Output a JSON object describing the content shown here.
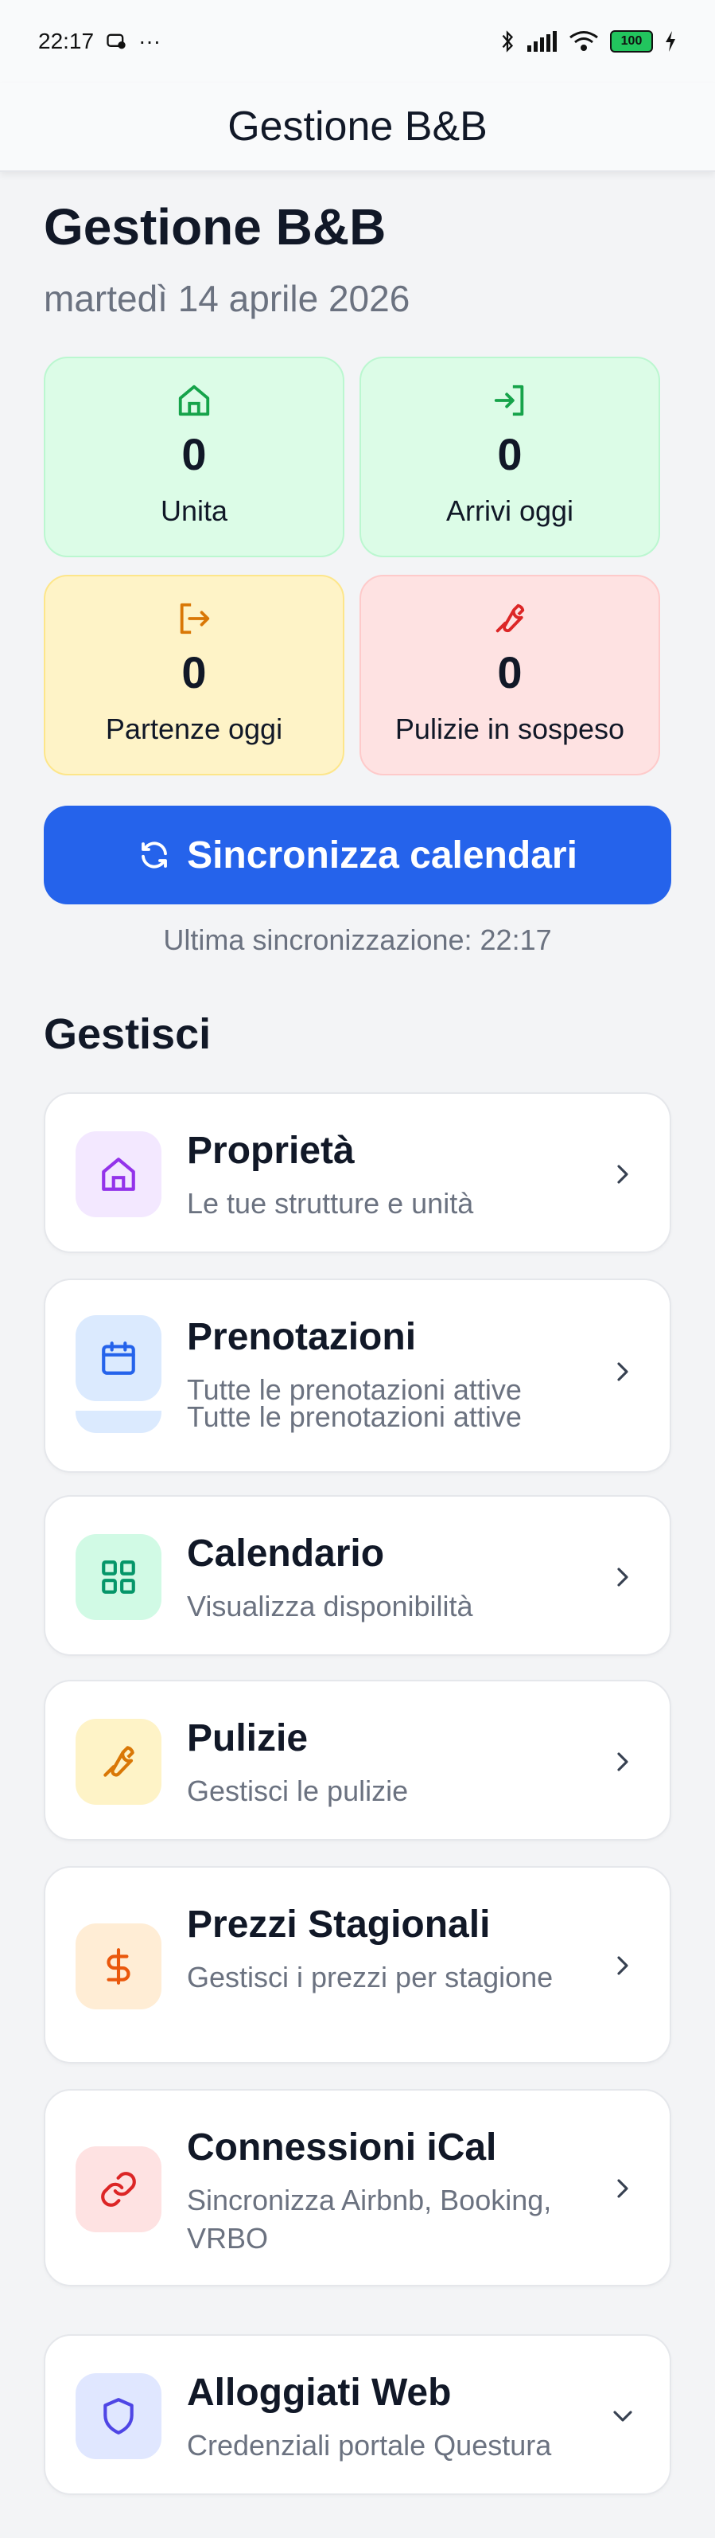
{
  "status_bar": {
    "time": "22:17",
    "dots": "···",
    "battery": "100"
  },
  "app_bar": {
    "title": "Gestione B&B"
  },
  "header": {
    "title": "Gestione B&B",
    "date": "martedì 14 aprile 2026"
  },
  "stats": [
    {
      "value": "0",
      "label": "Unita"
    },
    {
      "value": "0",
      "label": "Arrivi oggi"
    },
    {
      "value": "0",
      "label": "Partenze oggi"
    },
    {
      "value": "0",
      "label": "Pulizie in sospeso"
    }
  ],
  "sync": {
    "label": "Sincronizza calendari",
    "last_sync": "Ultima sincronizzazione: 22:17"
  },
  "manage": {
    "title": "Gestisci",
    "items": [
      {
        "title": "Proprietà",
        "subtitle": "Le tue strutture e unità"
      },
      {
        "title": "Prenotazioni",
        "subtitle": "Tutte le prenotazioni attive"
      },
      {
        "title": "Calendario",
        "subtitle": "Visualizza disponibilità"
      },
      {
        "title": "Pulizie",
        "subtitle": "Gestisci le pulizie"
      },
      {
        "title": "Prezzi Stagionali",
        "subtitle": "Gestisci i prezzi per stagione"
      },
      {
        "title": "Connessioni iCal",
        "subtitle": "Sincronizza Airbnb, Booking, VRBO"
      },
      {
        "title": "Alloggiati Web",
        "subtitle": "Credenziali portale Questura"
      }
    ]
  },
  "colors": {
    "primary": "#2563eb",
    "green_bg": "#dcfce7",
    "yellow_bg": "#fef3c7",
    "red_bg": "#fee2e2"
  }
}
